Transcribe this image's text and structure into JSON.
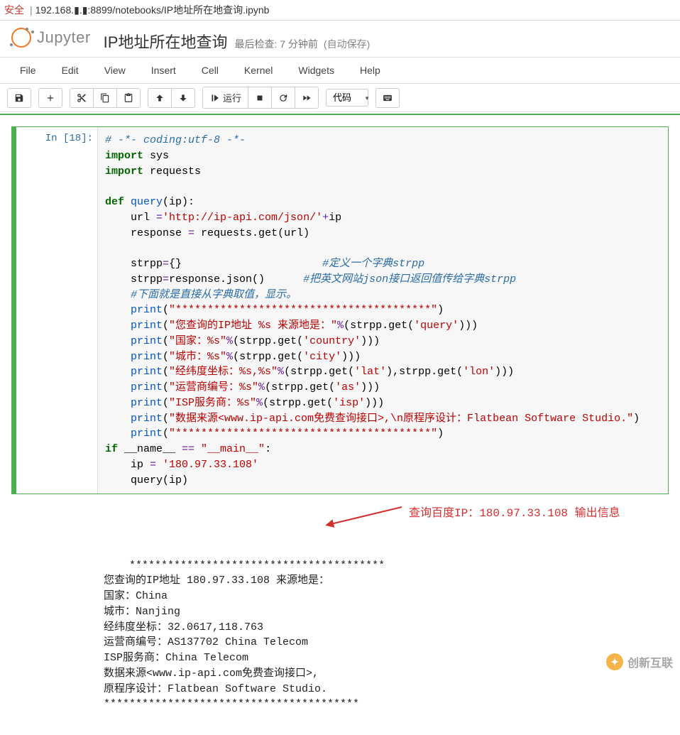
{
  "urlbar": {
    "status": "安全",
    "addr": "192.168.▮.▮:8899/notebooks/IP地址所在地查询.ipynb"
  },
  "header": {
    "logo_text": "Jupyter",
    "title": "IP地址所在地查询",
    "last_checked": "最后检查: 7 分钟前",
    "autosave": "(自动保存)"
  },
  "menu": {
    "file": "File",
    "edit": "Edit",
    "view": "View",
    "insert": "Insert",
    "cell": "Cell",
    "kernel": "Kernel",
    "widgets": "Widgets",
    "help": "Help"
  },
  "toolbar": {
    "run": "运行",
    "celltype": "代码"
  },
  "cell": {
    "prompt": "In  [18]:",
    "code": {
      "l1_cmt": "# -*- coding:utf-8 -*-",
      "l2_kw": "import",
      "l2_mod": " sys",
      "l3_kw": "import",
      "l3_mod": " requests",
      "l5_def": "def",
      "l5_fn": " query",
      "l5_sig": "(ip):",
      "l6": "    url ",
      "l6_op": "=",
      "l6_s1": "'http://ip-api.com/json/'",
      "l6_op2": "+",
      "l6_v": "ip",
      "l7": "    response ",
      "l7_op": "=",
      "l7_r": " requests.get(url)",
      "l9": "    strpp",
      "l9_op": "=",
      "l9_b": "{}                      ",
      "l9_cmt": "#定义一个字典strpp",
      "l10": "    strpp",
      "l10_op": "=",
      "l10_r": "response.json()      ",
      "l10_cmt": "#把英文网站json接口返回值传给字典strpp",
      "l11_cmt": "    #下面就是直接从字典取值，显示。",
      "l12_fn": "    print",
      "l12_a": "(",
      "l12_s": "\"****************************************\"",
      "l12_c": ")",
      "l13_fn": "    print",
      "l13_a": "(",
      "l13_s": "\"您查询的IP地址 %s 来源地是：\"",
      "l13_op": "%",
      "l13_r": "(strpp.get(",
      "l13_s2": "'query'",
      "l13_c": ")))",
      "l14_fn": "    print",
      "l14_a": "(",
      "l14_s": "\"国家：%s\"",
      "l14_op": "%",
      "l14_r": "(strpp.get(",
      "l14_s2": "'country'",
      "l14_c": ")))",
      "l15_fn": "    print",
      "l15_a": "(",
      "l15_s": "\"城市：%s\"",
      "l15_op": "%",
      "l15_r": "(strpp.get(",
      "l15_s2": "'city'",
      "l15_c": ")))",
      "l16_fn": "    print",
      "l16_a": "(",
      "l16_s": "\"经纬度坐标：%s,%s\"",
      "l16_op": "%",
      "l16_r": "(strpp.get(",
      "l16_s2": "'lat'",
      "l16_m": "),strpp.get(",
      "l16_s3": "'lon'",
      "l16_c": ")))",
      "l17_fn": "    print",
      "l17_a": "(",
      "l17_s": "\"运营商编号：%s\"",
      "l17_op": "%",
      "l17_r": "(strpp.get(",
      "l17_s2": "'as'",
      "l17_c": ")))",
      "l18_fn": "    print",
      "l18_a": "(",
      "l18_s": "\"ISP服务商：%s\"",
      "l18_op": "%",
      "l18_r": "(strpp.get(",
      "l18_s2": "'isp'",
      "l18_c": ")))",
      "l19_fn": "    print",
      "l19_a": "(",
      "l19_s": "\"数据来源<www.ip-api.com免费查询接口>,\\n原程序设计：Flatbean Software Studio.\"",
      "l19_c": ")",
      "l20_fn": "    print",
      "l20_a": "(",
      "l20_s": "\"****************************************\"",
      "l20_c": ")",
      "l21_if": "if",
      "l21_n": " __name__ ",
      "l21_op": "==",
      "l21_s": " \"__main__\"",
      "l21_c": ":",
      "l22": "    ip ",
      "l22_op": "=",
      "l22_s": " '180.97.33.108'",
      "l23": "    query(ip)"
    },
    "output": "****************************************\n您查询的IP地址 180.97.33.108 来源地是：\n国家：China\n城市：Nanjing\n经纬度坐标：32.0617,118.763\n运营商编号：AS137702 China Telecom\nISP服务商：China Telecom\n数据来源<www.ip-api.com免费查询接口>,\n原程序设计：Flatbean Software Studio.\n****************************************",
    "annotation": "查询百度IP：180.97.33.108 输出信息"
  },
  "watermark": "创新互联"
}
